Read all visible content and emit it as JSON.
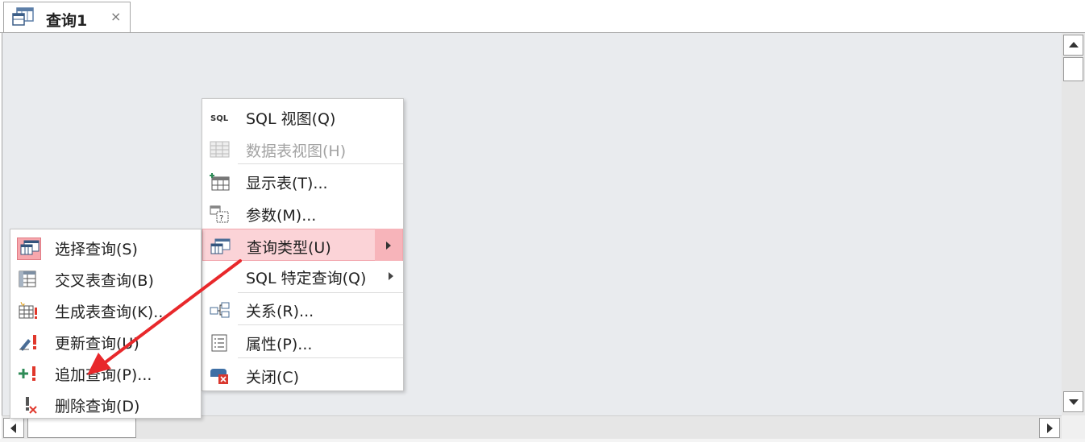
{
  "tab": {
    "title": "查询1",
    "close_glyph": "×",
    "icon": "query-icon"
  },
  "context_menu": {
    "items": [
      {
        "label": "SQL 视图(Q)",
        "icon": "sql-icon",
        "icon_text": "SQL",
        "enabled": true
      },
      {
        "label": "数据表视图(H)",
        "icon": "datasheet-icon",
        "enabled": false
      },
      {
        "label": "显示表(T)...",
        "icon": "show-table-icon",
        "enabled": true
      },
      {
        "label": "参数(M)...",
        "icon": "parameters-icon",
        "enabled": true
      },
      {
        "label": "查询类型(U)",
        "icon": "query-type-icon",
        "enabled": true,
        "highlighted": true,
        "submenu": true
      },
      {
        "label": "SQL 特定查询(Q)",
        "icon": "",
        "enabled": true,
        "submenu": true
      },
      {
        "label": "关系(R)...",
        "icon": "relationships-icon",
        "enabled": true
      },
      {
        "label": "属性(P)...",
        "icon": "properties-icon",
        "enabled": true
      },
      {
        "label": "关闭(C)",
        "icon": "close-query-icon",
        "enabled": true
      }
    ]
  },
  "query_type_submenu": {
    "items": [
      {
        "label": "选择查询(S)",
        "icon": "select-query-icon",
        "selected": true
      },
      {
        "label": "交叉表查询(B)",
        "icon": "crosstab-query-icon"
      },
      {
        "label": "生成表查询(K)...",
        "icon": "make-table-query-icon"
      },
      {
        "label": "更新查询(U)",
        "icon": "update-query-icon"
      },
      {
        "label": "追加查询(P)...",
        "icon": "append-query-icon"
      },
      {
        "label": "删除查询(D)",
        "icon": "delete-query-icon"
      }
    ]
  },
  "annotation": {
    "icon": "red-arrow-icon",
    "color": "#e8282b"
  },
  "colors": {
    "highlight": "#fbd3d7",
    "highlight_border": "#f2a7ae",
    "canvas": "#e9ebee"
  }
}
